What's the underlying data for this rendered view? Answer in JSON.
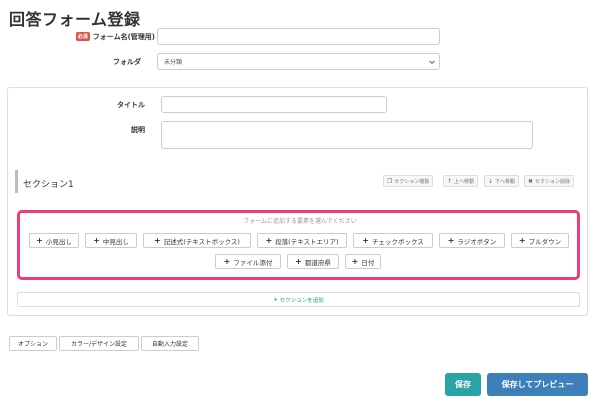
{
  "page": {
    "title": "回答フォーム登録"
  },
  "form_name": {
    "required_badge": "必須",
    "label": "フォーム名(管理用)",
    "value": ""
  },
  "folder": {
    "label": "フォルダ",
    "value": "未分類"
  },
  "fields": {
    "title_label": "タイトル",
    "title_value": "",
    "description_label": "説明",
    "description_value": ""
  },
  "section": {
    "title": "セクション1",
    "actions": [
      {
        "icon": "copy-icon",
        "glyph": "❐",
        "label": "セクション複製"
      },
      {
        "icon": "arrow-up-icon",
        "glyph": "↑",
        "label": "上へ移動"
      },
      {
        "icon": "arrow-down-icon",
        "glyph": "↓",
        "label": "下へ移動"
      },
      {
        "icon": "close-icon",
        "glyph": "✖",
        "label": "セクション削除"
      }
    ]
  },
  "picker": {
    "hint": "フォームに追加する要素を選んでください",
    "row1": [
      "小見出し",
      "中見出し",
      "記述式(テキストボックス)",
      "段落(テキストエリア)",
      "チェックボックス",
      "ラジオボタン",
      "プルダウン"
    ],
    "row2": [
      "ファイル添付",
      "都道府県",
      "日付"
    ]
  },
  "add_section": {
    "label": "セクションを追加"
  },
  "tabs": [
    "オプション",
    "カラー/デザイン設定",
    "自動入力設定"
  ],
  "buttons": {
    "save": "保存",
    "save_preview": "保存してプレビュー"
  },
  "colors": {
    "accent_teal": "#2aa3a3",
    "preview_blue": "#3d7fb8",
    "picker_border": "#ec3d76",
    "required_red": "#d9534f"
  }
}
